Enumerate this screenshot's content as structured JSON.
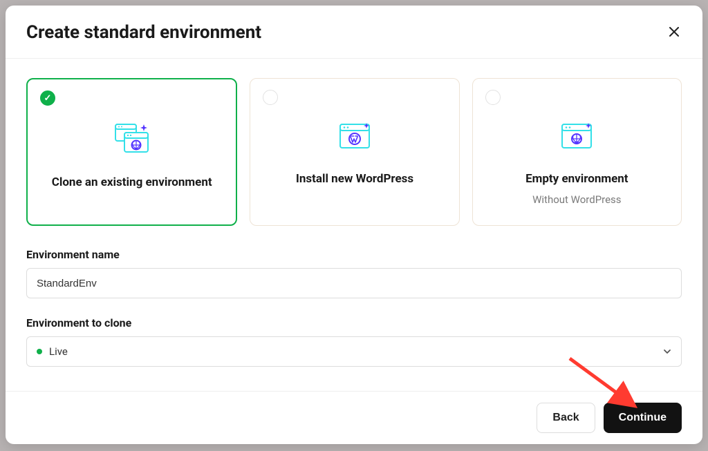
{
  "modal": {
    "title": "Create standard environment"
  },
  "options": [
    {
      "label": "Clone an existing environment",
      "sublabel": "",
      "selected": true
    },
    {
      "label": "Install new WordPress",
      "sublabel": "",
      "selected": false
    },
    {
      "label": "Empty environment",
      "sublabel": "Without WordPress",
      "selected": false
    }
  ],
  "fields": {
    "env_name_label": "Environment name",
    "env_name_value": "StandardEnv",
    "clone_label": "Environment to clone",
    "clone_value": "Live"
  },
  "footer": {
    "back": "Back",
    "continue": "Continue"
  }
}
